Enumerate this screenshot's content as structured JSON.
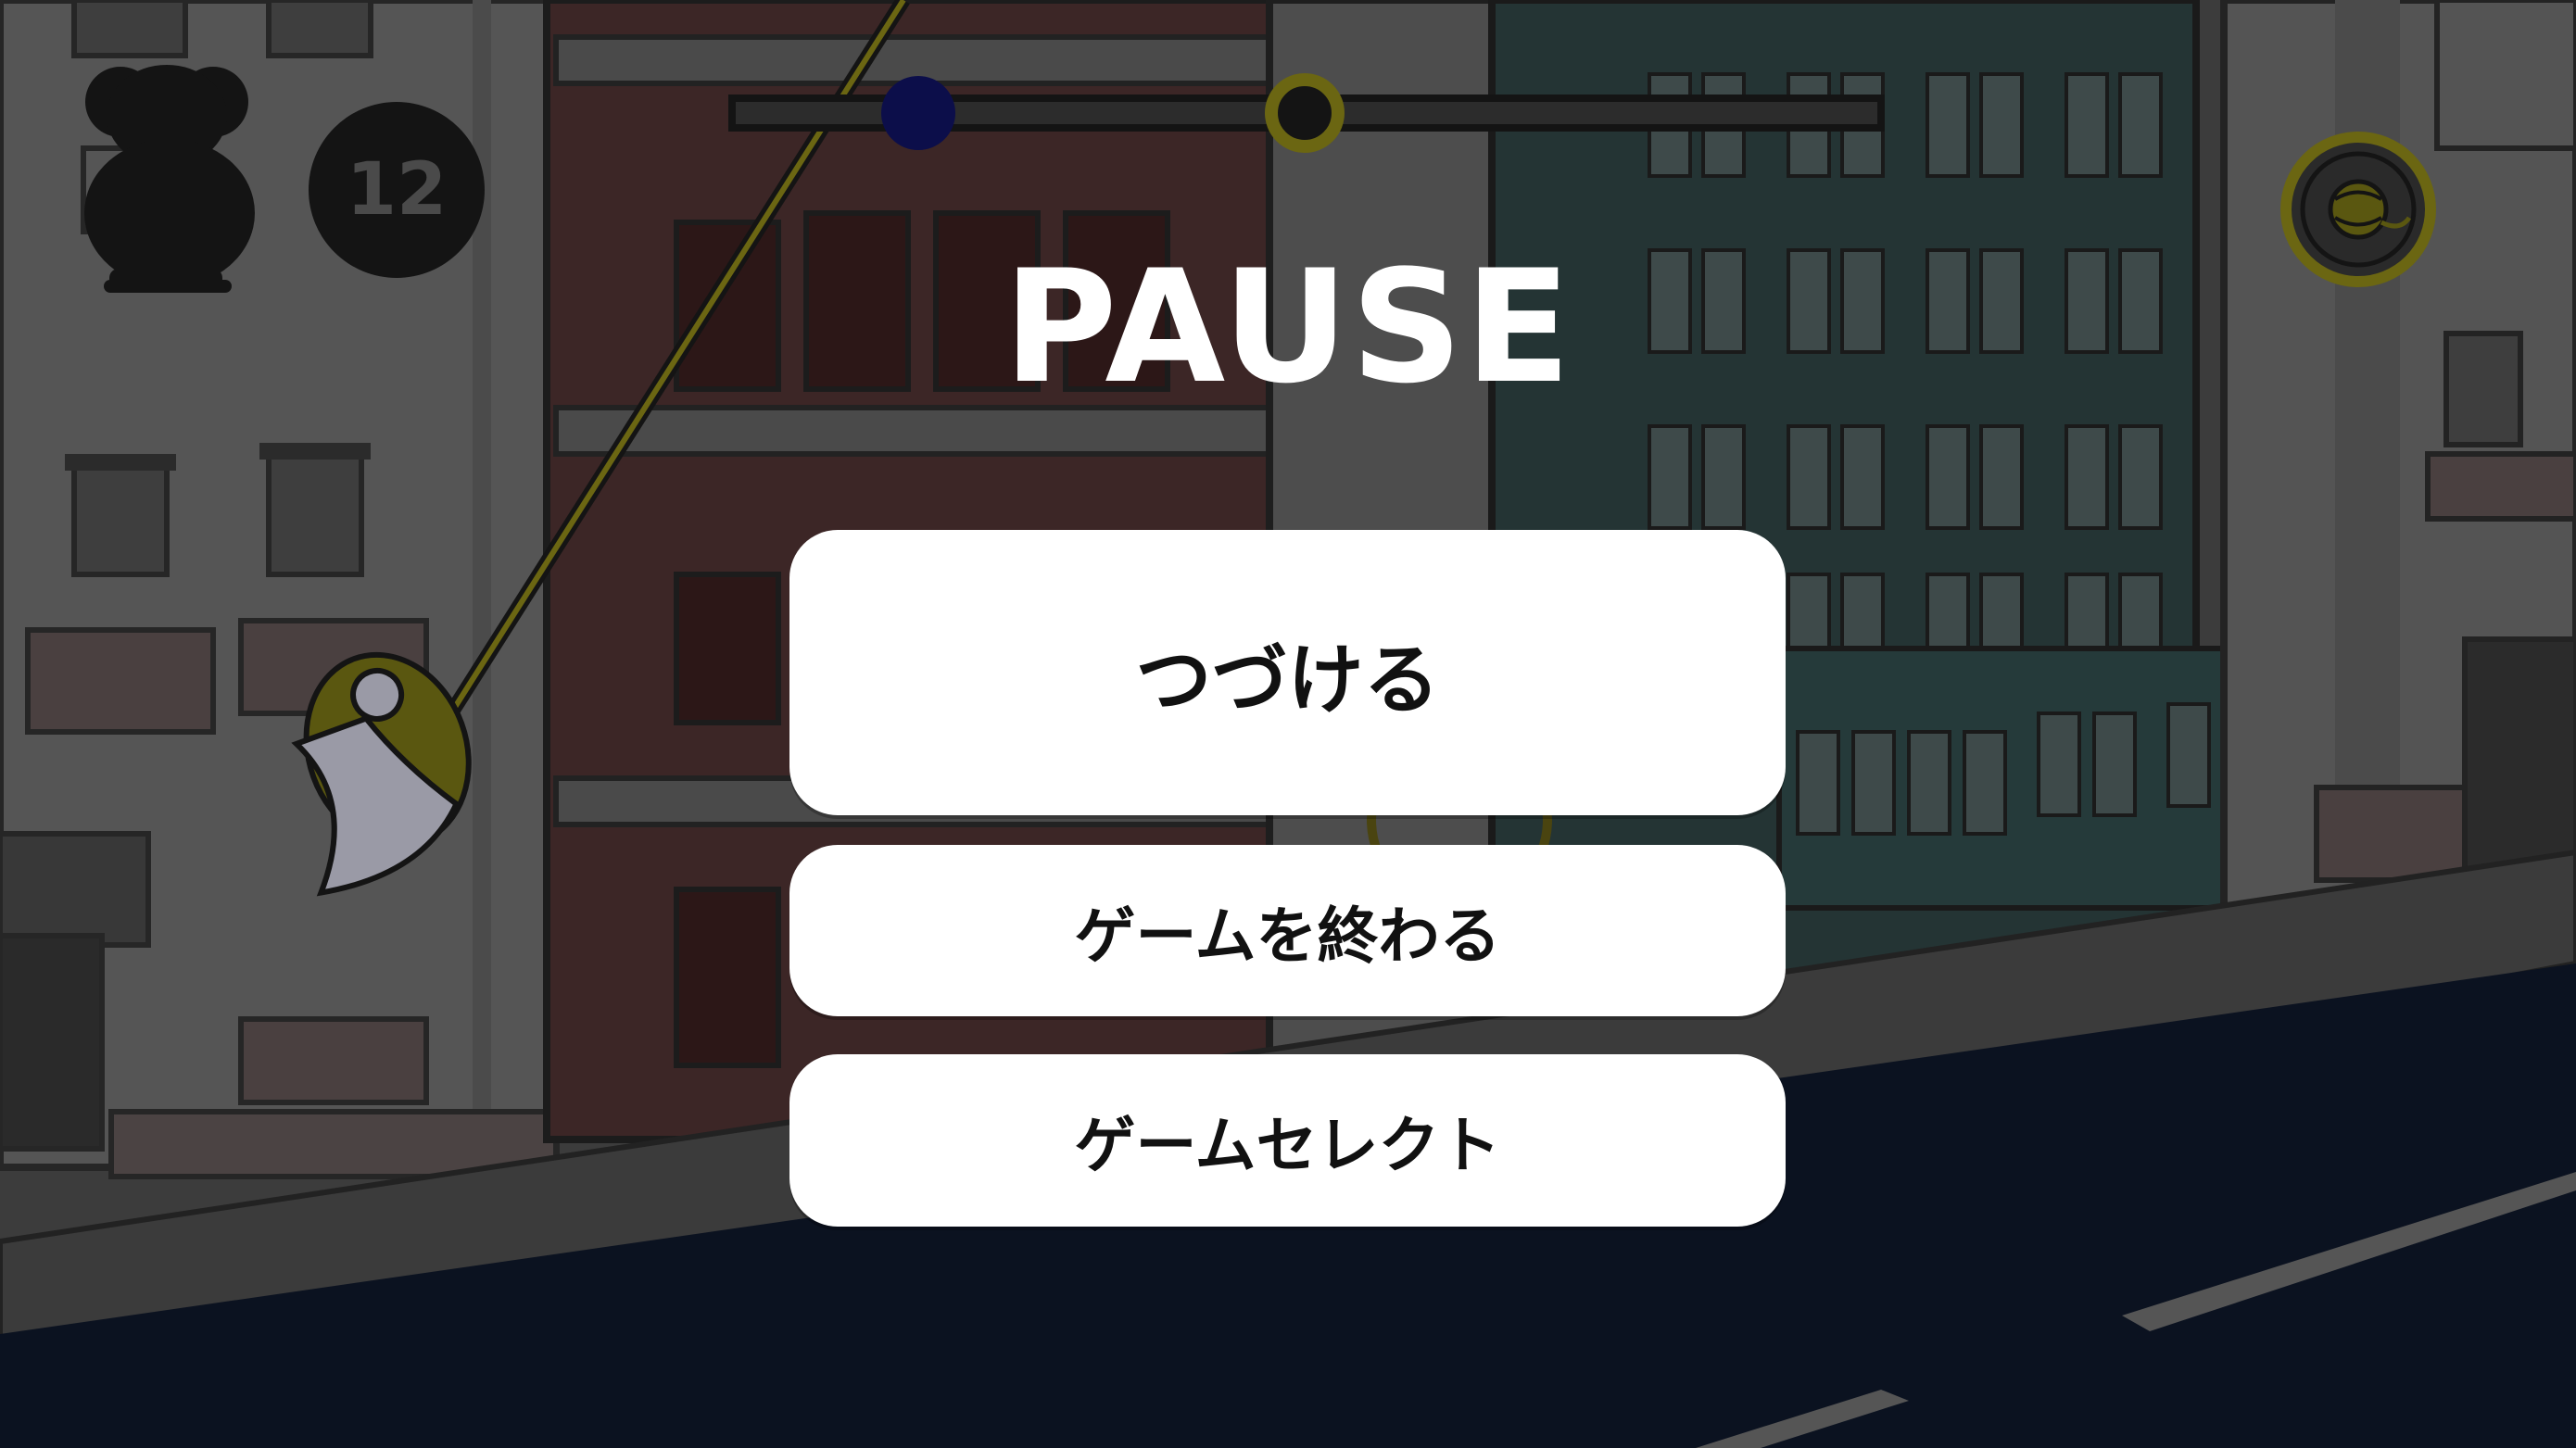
{
  "hud": {
    "score": "12",
    "stage_progress": 0.5,
    "player_marker": "navy-circle",
    "goal_marker": "yarn-ring-marker",
    "collectible_icon": "yarn-ball-icon",
    "character_icon": "sheep-silhouette-icon"
  },
  "pause": {
    "title": "PAUSE",
    "continue_label": "つづける",
    "end_game_label": "ゲームを終わる",
    "game_select_label": "ゲームセレクト"
  },
  "colors": {
    "accent_yellow": "#6b6612",
    "player_navy": "#0c0e4a",
    "button_bg": "#ffffff",
    "overlay_text": "#ffffff"
  }
}
